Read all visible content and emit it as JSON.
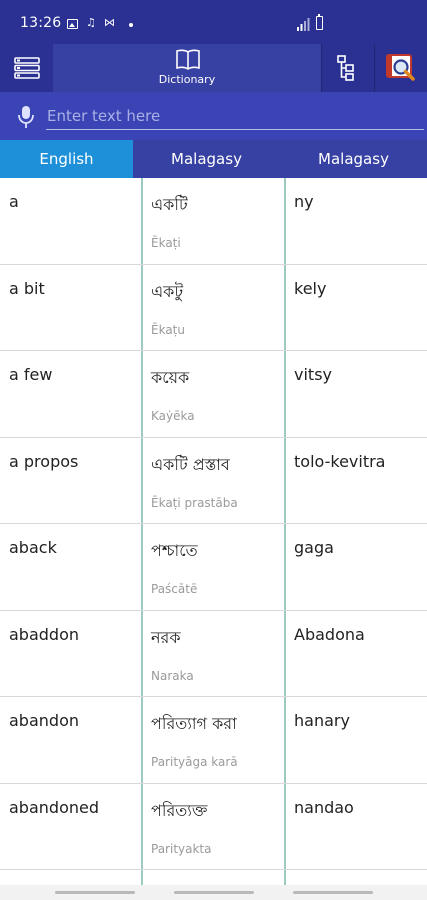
{
  "status_bar": {
    "time": "13:26",
    "icons": [
      "image-icon",
      "notification-icon",
      "media-icon",
      "dot-icon",
      "signal-icon",
      "battery-icon"
    ]
  },
  "toolbar": {
    "menu_icon": "menu-list-icon",
    "dictionary_label": "Dictionary",
    "dictionary_icon": "book-icon",
    "tree_icon": "tree-icon",
    "search_icon": "book-search-icon"
  },
  "search": {
    "placeholder": "Enter text here",
    "value": ""
  },
  "tabs": [
    {
      "label": "English"
    },
    {
      "label": "Malagasy"
    },
    {
      "label": "Malagasy"
    }
  ],
  "entries": [
    {
      "en": "a",
      "bn": "একটি",
      "translit": "Ēkaṭi",
      "mg": "ny"
    },
    {
      "en": "a bit",
      "bn": "একটু",
      "translit": "Ēkaṭu",
      "mg": "kely"
    },
    {
      "en": "a few",
      "bn": "কয়েক",
      "translit": "Kaẏēka",
      "mg": "vitsy"
    },
    {
      "en": "a propos",
      "bn": "একটি প্রস্তাব",
      "translit": "Ēkaṭi prastāba",
      "mg": "tolo-kevitra"
    },
    {
      "en": "aback",
      "bn": "পশ্চাতে",
      "translit": "Paścātē",
      "mg": "gaga"
    },
    {
      "en": "abaddon",
      "bn": "নরক",
      "translit": "Naraka",
      "mg": "Abadona"
    },
    {
      "en": "abandon",
      "bn": "পরিত্যাগ করা",
      "translit": "Parityāga karā",
      "mg": "hanary"
    },
    {
      "en": "abandoned",
      "bn": "পরিত্যক্ত",
      "translit": "Parityakta",
      "mg": "nandao"
    }
  ],
  "colors": {
    "primary": "#2a3192",
    "search_bg": "#3a44b5",
    "active_tab": "#1e90d9",
    "divider": "#9cc9c0"
  }
}
